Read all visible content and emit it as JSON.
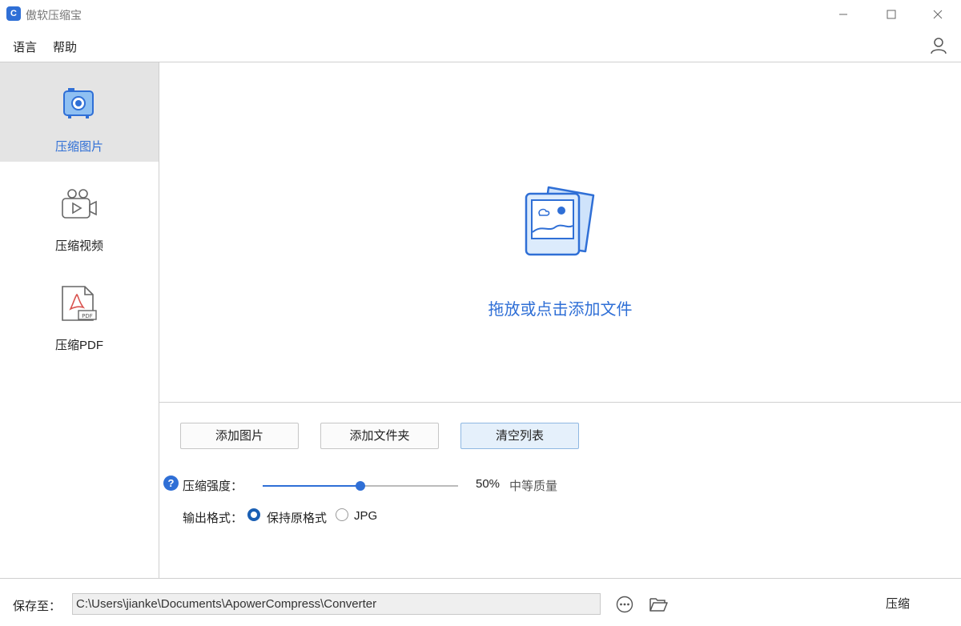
{
  "app": {
    "title": "傲软压缩宝",
    "icon_letter": "C"
  },
  "menu": {
    "language": "语言",
    "help": "帮助"
  },
  "sidebar": {
    "items": [
      {
        "label": "压缩图片",
        "icon": "image-compress-icon",
        "active": true
      },
      {
        "label": "压缩视频",
        "icon": "video-camera-icon",
        "active": false
      },
      {
        "label": "压缩PDF",
        "icon": "pdf-file-icon",
        "active": false
      }
    ]
  },
  "dropzone": {
    "text": "拖放或点击添加文件",
    "icon": "image-stack-icon"
  },
  "buttons": {
    "add_image": "添加图片",
    "add_folder": "添加文件夹",
    "clear_list": "清空列表"
  },
  "compression": {
    "label": "压缩强度：",
    "value_percent": 50,
    "value_text": "50%",
    "quality_text": "中等质量",
    "help_glyph": "?"
  },
  "output_format": {
    "label": "输出格式：",
    "options": [
      "保持原格式",
      "JPG"
    ],
    "selected": "保持原格式"
  },
  "save": {
    "label": "保存至：",
    "path": "C:\\Users\\jianke\\Documents\\ApowerCompress\\Converter"
  },
  "action": {
    "compress": "压缩"
  },
  "colors": {
    "accent": "#2f6fd6",
    "sidebar_active_bg": "#e4e4e4"
  }
}
